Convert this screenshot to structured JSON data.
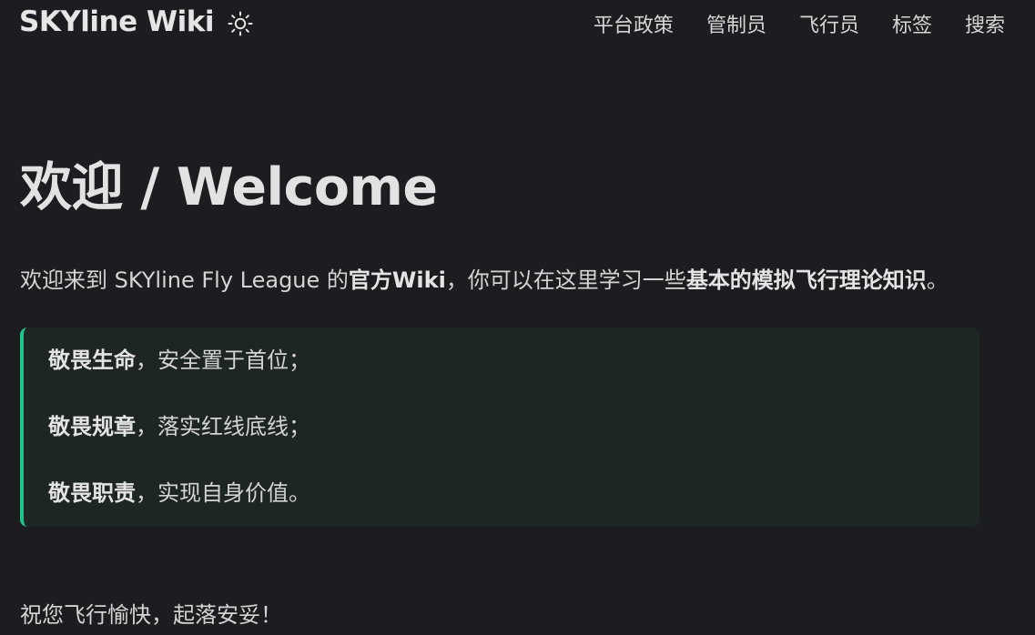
{
  "header": {
    "site_title": "SKYline Wiki",
    "theme_icon": "sun-icon",
    "nav": [
      {
        "label": "平台政策"
      },
      {
        "label": "管制员"
      },
      {
        "label": "飞行员"
      },
      {
        "label": "标签"
      },
      {
        "label": "搜索"
      }
    ]
  },
  "main": {
    "title": "欢迎 / Welcome",
    "intro": {
      "part1": "欢迎来到 SKYline Fly League 的",
      "bold1": "官方Wiki",
      "part2": "，你可以在这里学习一些",
      "bold2": "基本的模拟飞行理论知识",
      "part3": "。"
    },
    "callout": {
      "accent_color": "#1ec28b",
      "lines": [
        {
          "bold": "敬畏生命",
          "text": "，安全置于首位；"
        },
        {
          "bold": "敬畏规章",
          "text": "，落实红线底线；"
        },
        {
          "bold": "敬畏职责",
          "text": "，实现自身价值。"
        }
      ]
    },
    "outro": "祝您飞行愉快，起落安妥！"
  }
}
